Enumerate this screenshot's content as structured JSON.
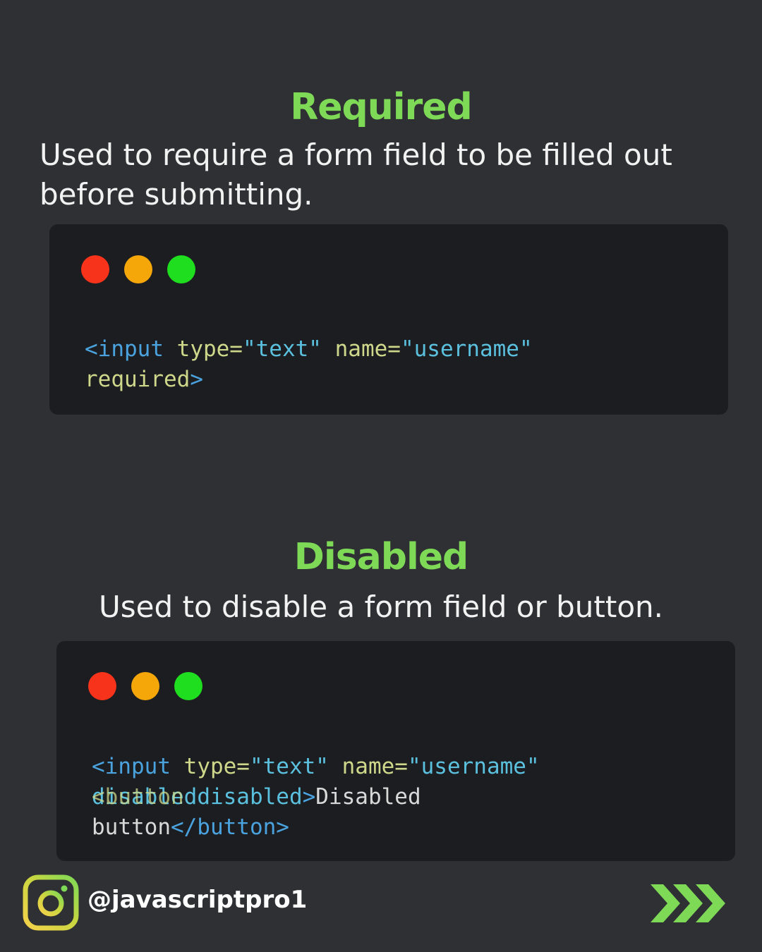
{
  "sections": [
    {
      "title": "Required",
      "description_lines": [
        "Used to require a form field to be filled out",
        "before submitting."
      ],
      "code": {
        "line1": {
          "tag_open": "<input",
          "attr1_name": "type=",
          "attr1_value": "\"text\"",
          "attr2_name": "name=",
          "attr2_value": "\"username\""
        },
        "line2": {
          "attr3_name": "required",
          "tag_close": ">"
        }
      }
    },
    {
      "title": "Disabled",
      "description_lines": [
        "Used to disable a form field or button."
      ],
      "code": {
        "line1": {
          "tag_open": "<input",
          "attr1_name": "type=",
          "attr1_value": "\"text\"",
          "attr2_name": "name=",
          "attr2_value": "\"username\""
        },
        "line2": {
          "overlap_a": "disabled",
          "overlap_b": "<button",
          "attr": "disabled",
          "tag_close": ">",
          "text": "Disabled"
        },
        "line3": {
          "text": "button",
          "close_tag": "</button>"
        }
      }
    }
  ],
  "window_dots": [
    "close-dot",
    "minimize-dot",
    "maximize-dot"
  ],
  "footer": {
    "handle": "@javascriptpro1",
    "icon": "instagram-icon",
    "next_icon": "triple-chevron-right-icon"
  },
  "colors": {
    "background": "#2e3034",
    "card": "#1b1d20",
    "heading_green": "#7ed957",
    "tag_blue": "#4aa3df",
    "attr_name": "#cfd88a",
    "attr_value": "#5bc0de",
    "plain_text": "#d8d8d8",
    "dot_red": "#f7341b",
    "dot_yellow": "#f5a70a",
    "dot_green": "#1fdd1f"
  }
}
